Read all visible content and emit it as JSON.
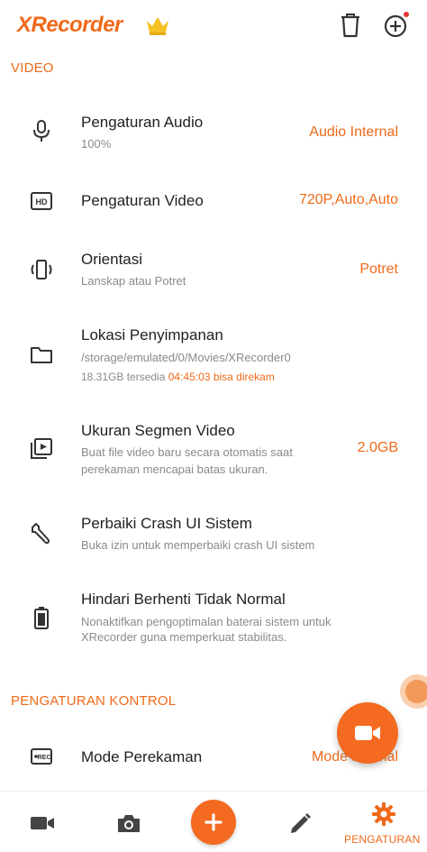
{
  "header": {
    "app_name": "XRecorder",
    "icons": [
      "crown-icon",
      "trash-icon",
      "add-circle-icon"
    ],
    "accent_color": "#ee6a1a",
    "badge_color": "#e53935"
  },
  "sections": [
    {
      "title": "VIDEO",
      "items": [
        {
          "icon": "microphone-icon",
          "title": "Pengaturan Audio",
          "subtitle": "100%",
          "value": "Audio Internal"
        },
        {
          "icon": "hd-icon",
          "title": "Pengaturan Video",
          "value": "720P,Auto,Auto"
        },
        {
          "icon": "screen-rotation-icon",
          "title": "Orientasi",
          "subtitle": "Lanskap atau Potret",
          "value": "Potret"
        },
        {
          "icon": "folder-icon",
          "title": "Lokasi Penyimpanan",
          "subtitle": "/storage/emulated/0/Movies/XRecorder0",
          "storage": {
            "available": "18.31GB tersedia",
            "duration": "04:45:03",
            "suffix": "bisa direkam"
          }
        },
        {
          "icon": "video-library-icon",
          "title": "Ukuran Segmen Video",
          "subtitle_lines": [
            "Buat file video baru secara otomatis saat",
            "perekaman mencapai batas ukuran."
          ],
          "value": "2.0GB"
        },
        {
          "icon": "wrench-icon",
          "title": "Perbaiki Crash UI Sistem",
          "subtitle": "Buka izin untuk memperbaiki crash UI sistem"
        },
        {
          "icon": "battery-icon",
          "title": "Hindari Berhenti Tidak Normal",
          "subtitle_lines": [
            "Nonaktifkan pengoptimalan baterai sistem untuk",
            "XRecorder guna memperkuat stabilitas."
          ]
        }
      ]
    },
    {
      "title": "PENGATURAN KONTROL",
      "items": [
        {
          "icon": "rec-icon",
          "title": "Mode Perekaman",
          "value": "Mode Normal"
        }
      ]
    }
  ],
  "bottom_nav": {
    "items": [
      {
        "icon": "video-camera-icon"
      },
      {
        "icon": "camera-icon"
      },
      {
        "icon": "plus-icon"
      },
      {
        "icon": "pencil-icon"
      },
      {
        "icon": "gear-icon",
        "label": "PENGATURAN",
        "active": true
      }
    ]
  },
  "floating": {
    "icon": "record-video-icon"
  }
}
